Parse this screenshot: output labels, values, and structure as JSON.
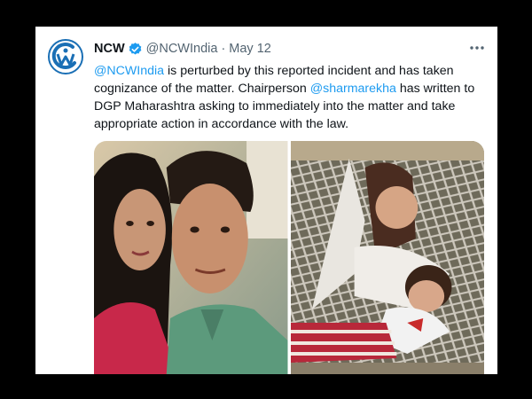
{
  "tweet": {
    "author_name": "NCW",
    "handle": "@NCWIndia",
    "separator": "·",
    "date": "May 12",
    "text": {
      "mention1": "@NCWIndia",
      "part1": " is perturbed by this reported incident and has taken cognizance of the matter. Chairperson ",
      "mention2": "@sharmarekha",
      "part2": " has written to DGP Maharashtra asking to immediately into the matter and take appropriate action in accordance with the law."
    },
    "media": [
      {
        "icon": "photo-couple"
      },
      {
        "icon": "photo-hammock"
      }
    ]
  },
  "colors": {
    "accent": "#1d9bf0",
    "verified": "#1d9bf0",
    "text": "#0f1419",
    "secondary": "#536471",
    "frame_background": "#000000"
  }
}
